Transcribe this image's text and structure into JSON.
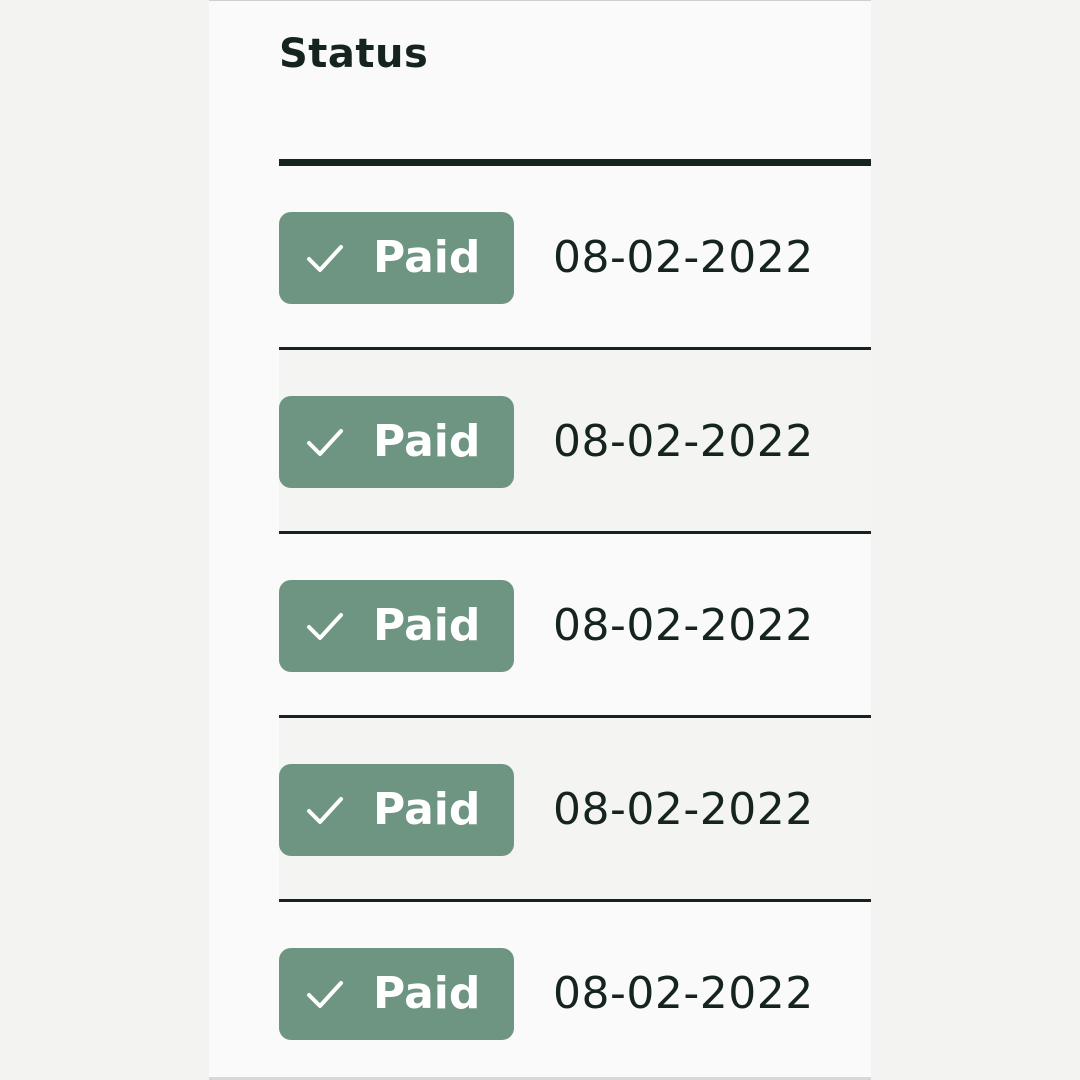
{
  "table": {
    "header": {
      "status_label": "Status"
    },
    "rows": [
      {
        "status": "Paid",
        "status_icon": "check-icon",
        "date": "08-02-2022"
      },
      {
        "status": "Paid",
        "status_icon": "check-icon",
        "date": "08-02-2022"
      },
      {
        "status": "Paid",
        "status_icon": "check-icon",
        "date": "08-02-2022"
      },
      {
        "status": "Paid",
        "status_icon": "check-icon",
        "date": "08-02-2022"
      },
      {
        "status": "Paid",
        "status_icon": "check-icon",
        "date": "08-02-2022"
      }
    ]
  },
  "colors": {
    "background": "#f3f3f2",
    "panel": "#fafafa",
    "text": "#16241f",
    "badge": "#6e9582",
    "badge_text": "#ffffff"
  }
}
